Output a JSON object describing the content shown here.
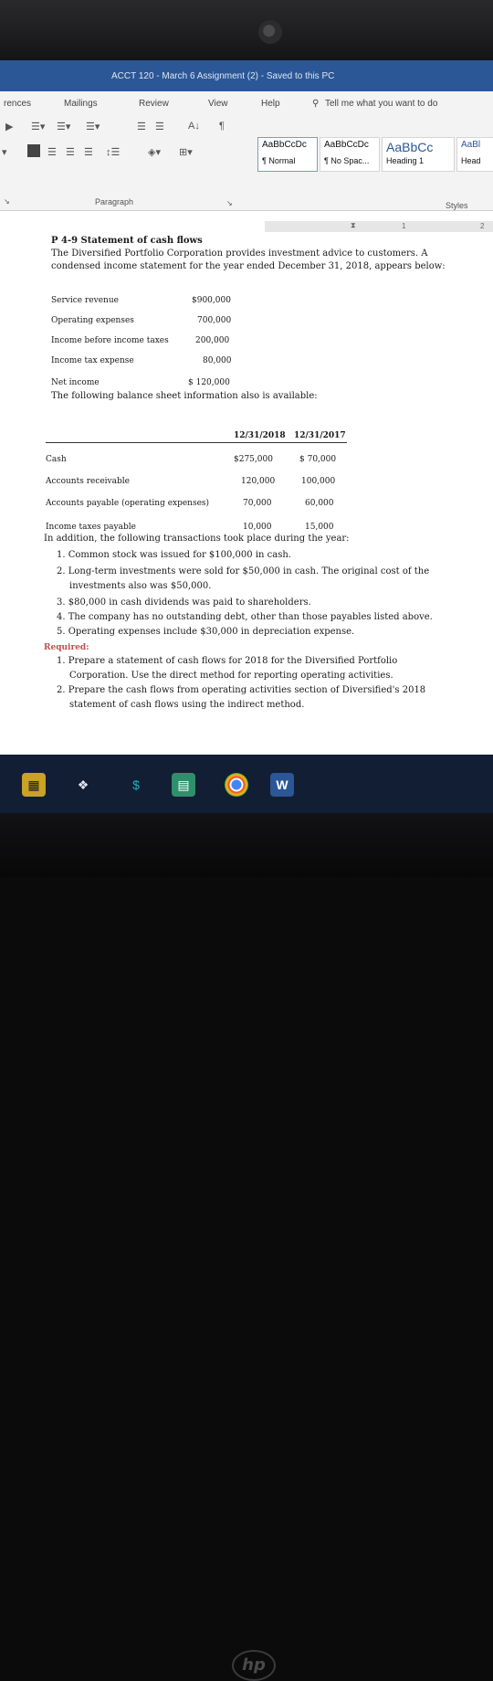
{
  "window": {
    "title": "ACCT 120 - March 6 Assignment (2) - Saved to this PC"
  },
  "ribbon_tabs": [
    "rences",
    "Mailings",
    "Review",
    "View",
    "Help"
  ],
  "tell_me": {
    "placeholder": "Tell me what you want to do"
  },
  "styles": [
    {
      "sample": "AaBbCcDc",
      "name": "¶ Normal"
    },
    {
      "sample": "AaBbCcDc",
      "name": "¶ No Spac..."
    },
    {
      "sample": "AaBbCc",
      "name": "Heading 1"
    },
    {
      "sample": "AaBl",
      "name": "Head"
    }
  ],
  "group_labels": {
    "paragraph": "Paragraph",
    "styles": "Styles"
  },
  "document": {
    "heading": "P 4-9 Statement of cash flows",
    "intro1": "The Diversified Portfolio Corporation provides investment advice to customers. A",
    "intro2": "condensed income statement for the year ended December 31, 2018, appears below:",
    "income": [
      {
        "label": "Service revenue",
        "value": "$900,000"
      },
      {
        "label": "Operating expenses",
        "value": "700,000"
      },
      {
        "label": "Income before income taxes",
        "value": "200,000"
      },
      {
        "label": "Income tax expense",
        "value": "80,000"
      },
      {
        "label": "Net income",
        "value": "$ 120,000"
      }
    ],
    "balance_intro": "The following balance sheet information also is available:",
    "balance_headers": [
      "12/31/2018",
      "12/31/2017"
    ],
    "balance": [
      {
        "label": "Cash",
        "v2018": "$275,000",
        "v2017": "$ 70,000"
      },
      {
        "label": "Accounts receivable",
        "v2018": "120,000",
        "v2017": "100,000"
      },
      {
        "label": "Accounts payable (operating expenses)",
        "v2018": "70,000",
        "v2017": "60,000"
      },
      {
        "label": "Income taxes payable",
        "v2018": "10,000",
        "v2017": "15,000"
      }
    ],
    "transactions_intro": "In addition, the following transactions took place during the year:",
    "transactions": [
      "1. Common stock was issued for $100,000 in cash.",
      "2. Long-term investments were sold for $50,000 in cash. The original cost of the",
      "investments also was $50,000.",
      "3. $80,000 in cash dividends was paid to shareholders.",
      "4. The company has no outstanding debt, other than those payables listed above.",
      "5. Operating expenses include $30,000 in depreciation expense."
    ],
    "required_label": "Required:",
    "required": [
      "1. Prepare a statement of cash flows for 2018 for the Diversified Portfolio",
      "Corporation. Use the direct method for reporting operating activities.",
      "2. Prepare the cash flows from operating activities section of Diversified's 2018",
      "statement of cash flows using the indirect method."
    ]
  },
  "colors": {
    "titlebar": "#2b5797",
    "taskbar": "#121e33",
    "required": "#c0504d"
  },
  "taskbar_icons": [
    "store-icon",
    "dropbox-icon",
    "app-icon",
    "file-explorer-icon",
    "chrome-icon",
    "word-icon"
  ],
  "logo": "hp"
}
